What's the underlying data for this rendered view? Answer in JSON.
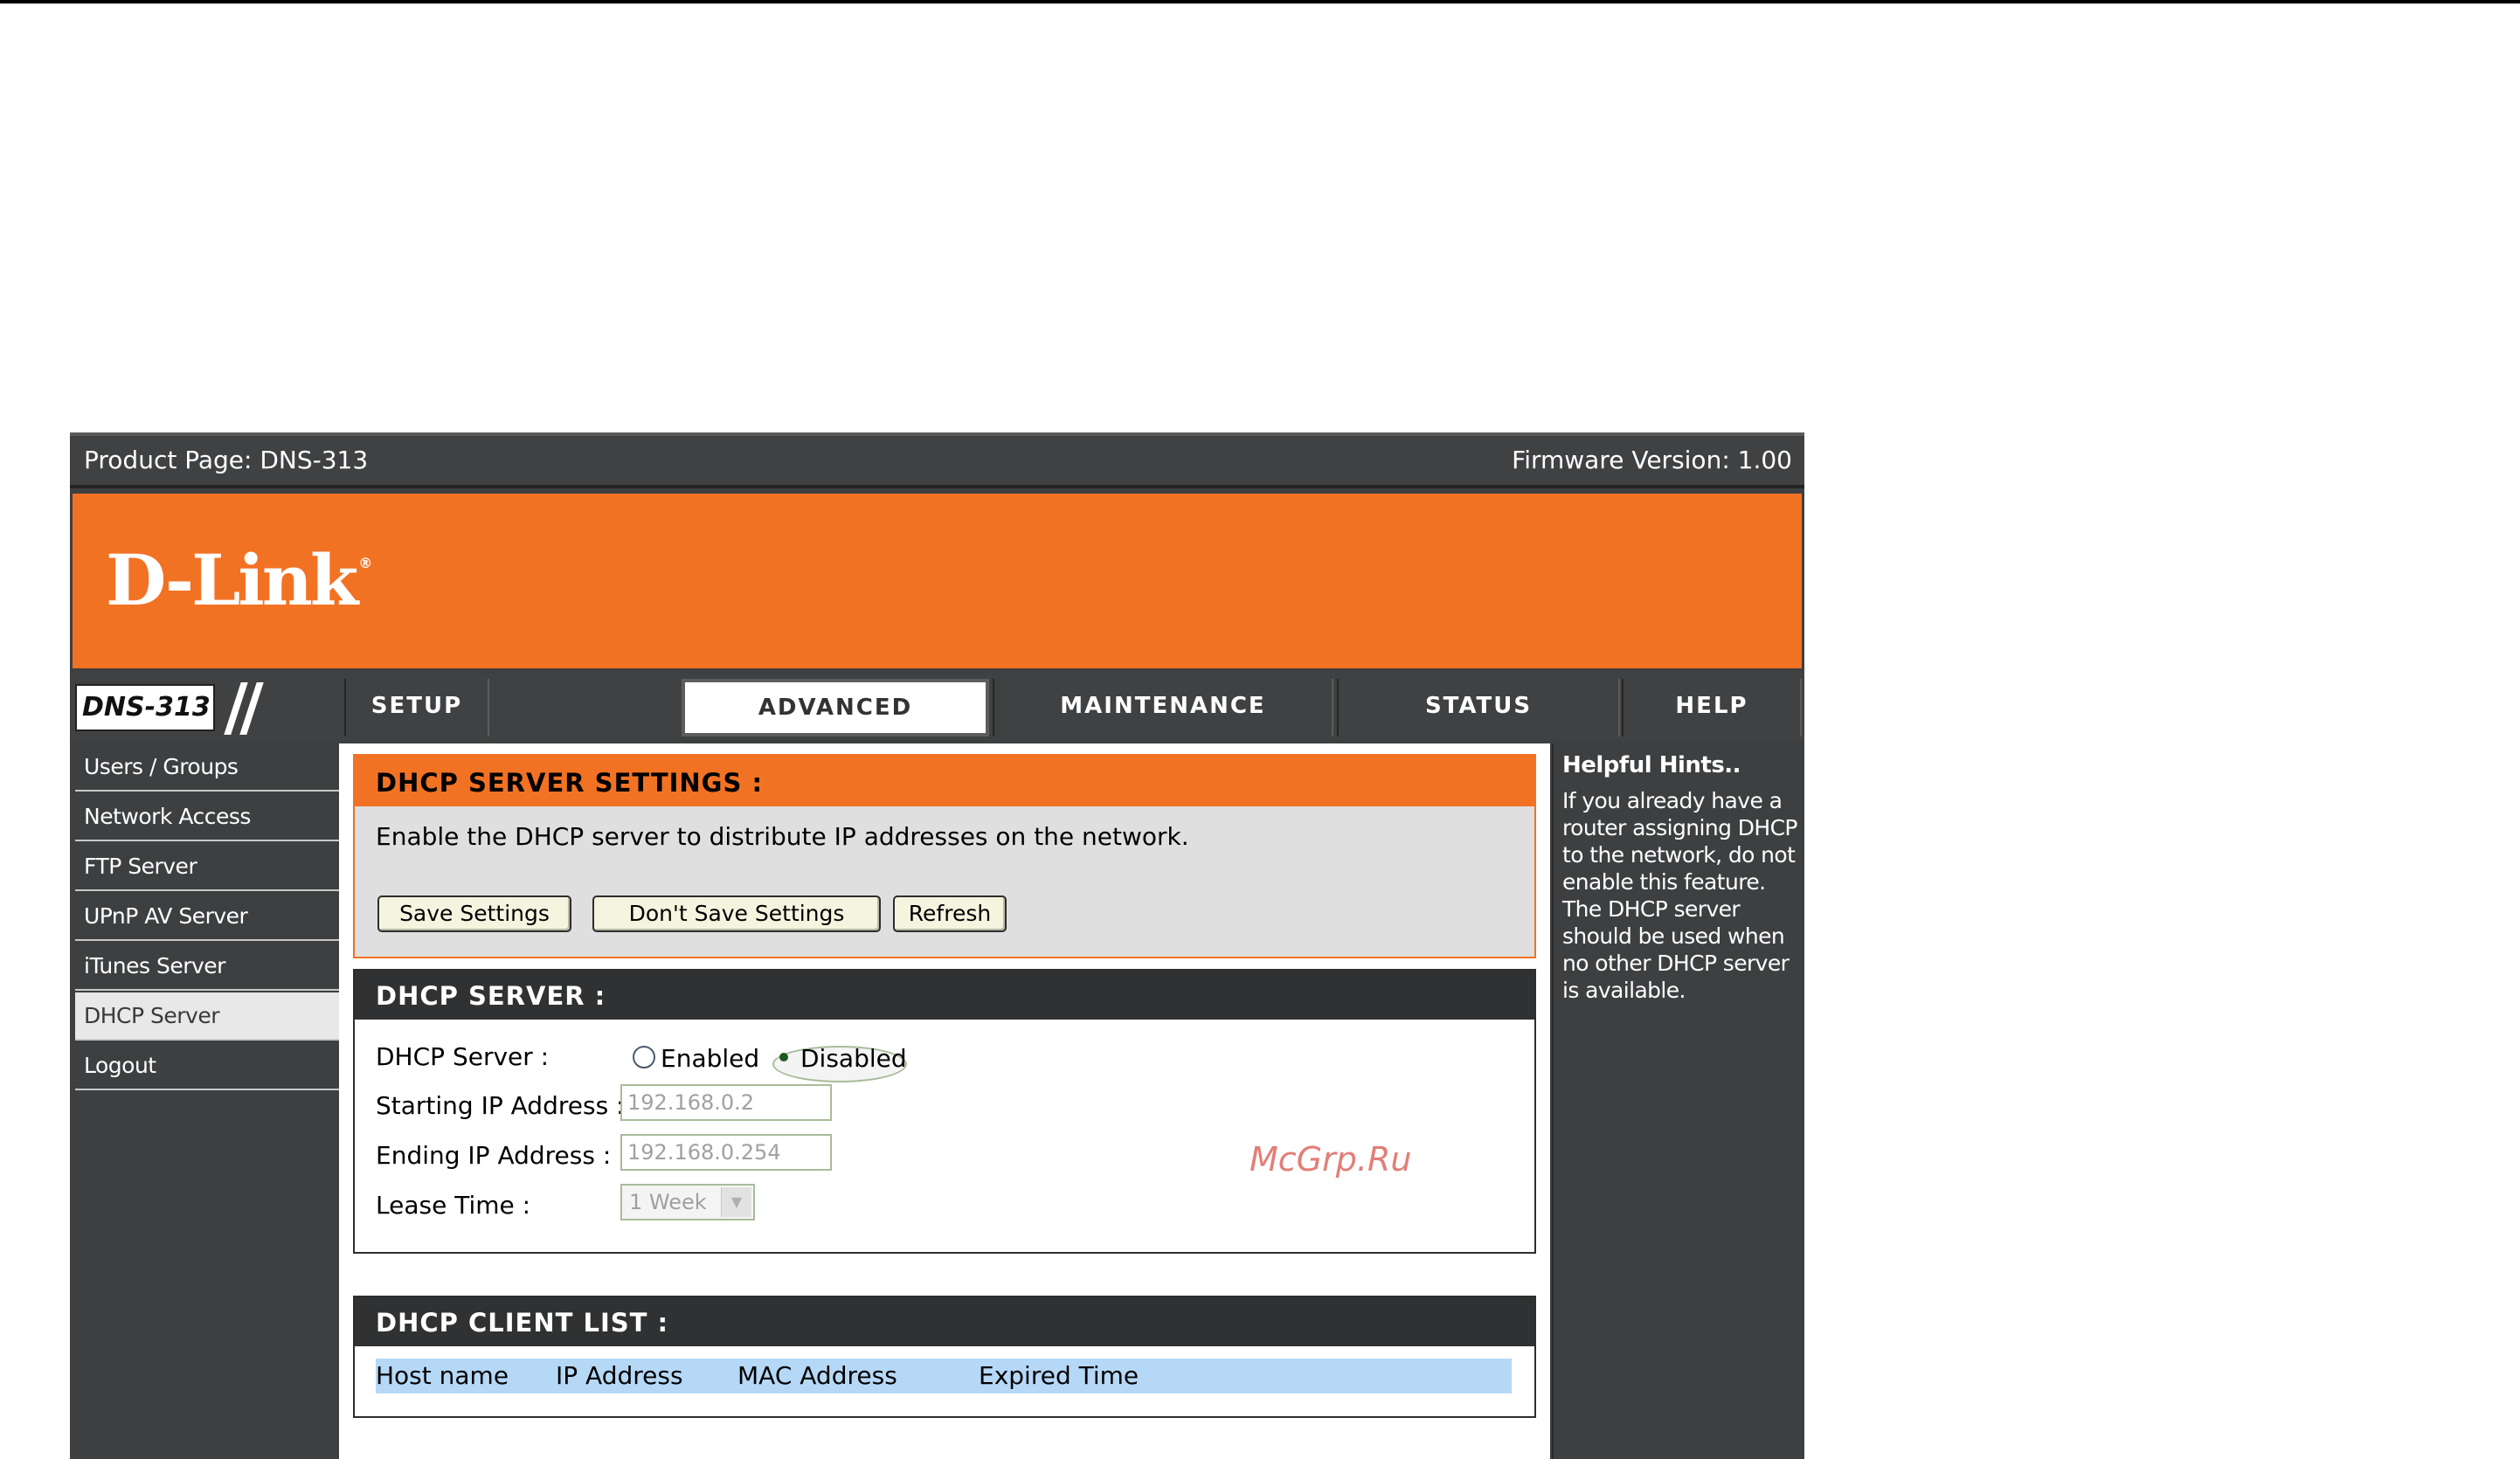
{
  "product_bar": {
    "product_page": "Product Page: DNS-313",
    "firmware": "Firmware Version: 1.00"
  },
  "brand": {
    "logo_text": "D-Link",
    "registered": "®",
    "model": "DNS-313"
  },
  "tabs": [
    {
      "label": "SETUP",
      "active": false
    },
    {
      "label": "ADVANCED",
      "active": true
    },
    {
      "label": "MAINTENANCE",
      "active": false
    },
    {
      "label": "STATUS",
      "active": false
    },
    {
      "label": "HELP",
      "active": false
    }
  ],
  "sidebar": {
    "items": [
      {
        "label": "Users / Groups"
      },
      {
        "label": "Network Access"
      },
      {
        "label": "FTP Server"
      },
      {
        "label": "UPnP AV Server"
      },
      {
        "label": "iTunes Server"
      },
      {
        "label": "DHCP Server",
        "active": true
      },
      {
        "label": "Logout"
      }
    ]
  },
  "settings": {
    "title": "DHCP SERVER SETTINGS :",
    "description": "Enable the DHCP server to distribute IP addresses on the network.",
    "buttons": {
      "save": "Save Settings",
      "dont_save": "Don't Save Settings",
      "refresh": "Refresh"
    }
  },
  "dhcp_server": {
    "title": "DHCP SERVER :",
    "server_label": "DHCP Server :",
    "enabled_label": "Enabled",
    "disabled_label": "Disabled",
    "selected": "Disabled",
    "start_ip_label": "Starting IP Address :",
    "start_ip_value": "192.168.0.2",
    "end_ip_label": "Ending IP Address :",
    "end_ip_value": "192.168.0.254",
    "lease_label": "Lease Time :",
    "lease_value": "1 Week"
  },
  "client_list": {
    "title": "DHCP CLIENT LIST :",
    "columns": [
      "Host name",
      "IP Address",
      "MAC Address",
      "Expired Time"
    ]
  },
  "help": {
    "title": "Helpful Hints..",
    "body": "If you already have a router assigning DHCP to the network, do not enable this feature. The DHCP server should be used when no other DHCP server is available."
  },
  "watermark": "McGrp.Ru"
}
